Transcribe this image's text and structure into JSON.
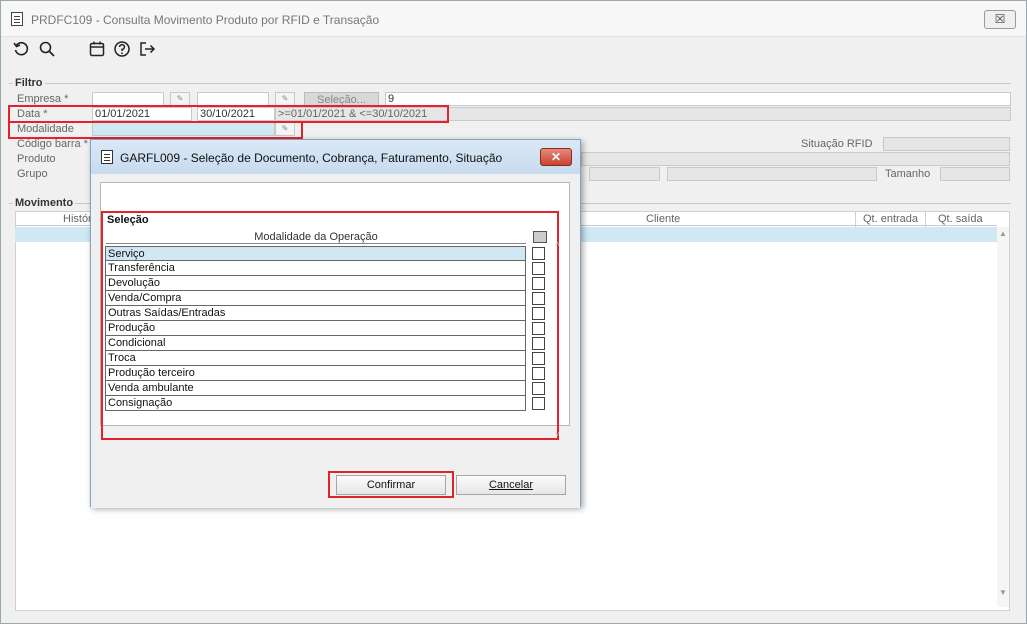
{
  "window": {
    "title": "PRDFC109 - Consulta Movimento Produto por RFID e Transação",
    "close_label": "☒"
  },
  "toolbar": {
    "icons": [
      "refresh-icon",
      "search-icon",
      "calendar-icon",
      "help-icon",
      "exit-icon"
    ]
  },
  "filtro": {
    "legend": "Filtro",
    "empresa_label": "Empresa *",
    "empresa_value": "",
    "selecao_button": "Seleção...",
    "selecao_value": "9",
    "data_label": "Data *",
    "data_from": "01/01/2021",
    "data_to": "30/10/2021",
    "data_expr": ">=01/01/2021 & <=30/10/2021",
    "modalidade_label": "Modalidade",
    "codigo_barra_label": "Código barra *",
    "produto_label": "Produto",
    "grupo_label": "Grupo",
    "situacao_rfid_label": "Situação RFID",
    "tamanho_label": "Tamanho"
  },
  "movimento": {
    "legend": "Movimento",
    "columns": {
      "historico": "Histór",
      "cliente": "Cliente",
      "qt_entrada": "Qt. entrada",
      "qt_saida": "Qt. saída"
    }
  },
  "dialog": {
    "title": "GARFL009 - Seleção de Documento, Cobrança, Faturamento, Situação",
    "close_label": "✕",
    "selecao_legend": "Seleção",
    "column_header": "Modalidade da Operação",
    "items": [
      {
        "label": "Serviço",
        "checked": false
      },
      {
        "label": "Transferência",
        "checked": false
      },
      {
        "label": "Devolução",
        "checked": false
      },
      {
        "label": "Venda/Compra",
        "checked": false
      },
      {
        "label": "Outras Saídas/Entradas",
        "checked": false
      },
      {
        "label": "Produção",
        "checked": false
      },
      {
        "label": "Condicional",
        "checked": false
      },
      {
        "label": "Troca",
        "checked": false
      },
      {
        "label": "Produção terceiro",
        "checked": false
      },
      {
        "label": "Venda ambulante",
        "checked": false
      },
      {
        "label": "Consignação",
        "checked": false
      }
    ],
    "confirm_label": "Confirmar",
    "cancel_label": "Cancelar"
  },
  "colors": {
    "highlight_red": "#e0232c",
    "selection_blue": "#cfe8f3",
    "dialog_title_blue": "#c7dbef"
  }
}
